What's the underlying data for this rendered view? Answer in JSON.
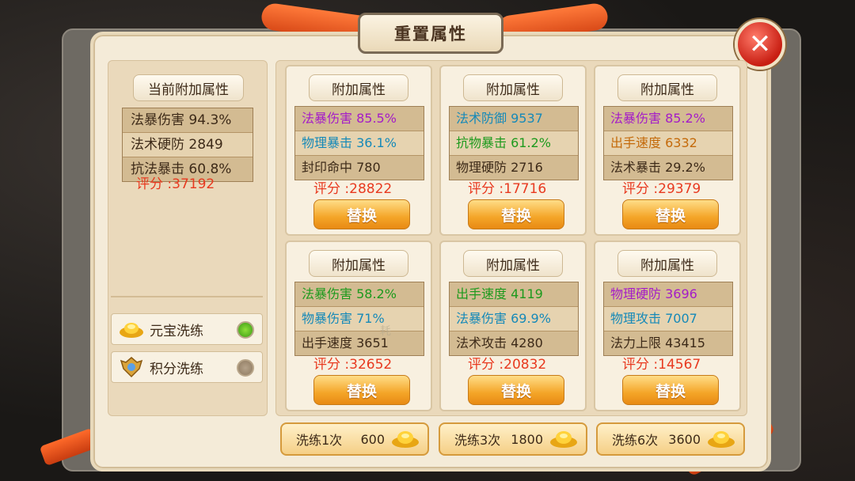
{
  "title": "重置属性",
  "current": {
    "label": "当前附加属性",
    "stats": [
      {
        "text": "法暴伤害 94.3%"
      },
      {
        "text": "法术硬防 2849"
      },
      {
        "text": "抗法暴击 60.8%"
      }
    ],
    "score": "评分 :37192"
  },
  "modes": [
    {
      "label": "元宝洗练",
      "icon": "gold-ingot-icon",
      "selected": true
    },
    {
      "label": "积分洗练",
      "icon": "points-badge-icon",
      "selected": false
    }
  ],
  "card_label": "附加属性",
  "swap_label": "替换",
  "cards": [
    {
      "stats": [
        {
          "text": "法暴伤害 85.5%",
          "color": "#a41cc8"
        },
        {
          "text": "物理暴击 36.1%",
          "color": "#1589b8"
        },
        {
          "text": "封印命中 780",
          "color": "#3d2a18"
        }
      ],
      "score": "评分 :28822"
    },
    {
      "stats": [
        {
          "text": "法术防御 9537",
          "color": "#1589b8"
        },
        {
          "text": "抗物暴击 61.2%",
          "color": "#1d9a1d"
        },
        {
          "text": "物理硬防 2716",
          "color": "#3d2a18"
        }
      ],
      "score": "评分 :17716"
    },
    {
      "stats": [
        {
          "text": "法暴伤害 85.2%",
          "color": "#a41cc8"
        },
        {
          "text": "出手速度 6332",
          "color": "#c46a0a"
        },
        {
          "text": "法术暴击 29.2%",
          "color": "#3d2a18"
        }
      ],
      "score": "评分 :29379"
    },
    {
      "stats": [
        {
          "text": "法暴伤害 58.2%",
          "color": "#1d9a1d"
        },
        {
          "text": "物暴伤害 71%",
          "color": "#1589b8"
        },
        {
          "text": "出手速度 3651",
          "color": "#3d2a18"
        }
      ],
      "score": "评分 :32652"
    },
    {
      "stats": [
        {
          "text": "出手速度 4119",
          "color": "#1d9a1d"
        },
        {
          "text": "法暴伤害 69.9%",
          "color": "#1589b8"
        },
        {
          "text": "法术攻击 4280",
          "color": "#3d2a18"
        }
      ],
      "score": "评分 :20832"
    },
    {
      "stats": [
        {
          "text": "物理硬防 3696",
          "color": "#a41cc8"
        },
        {
          "text": "物理攻击 7007",
          "color": "#1589b8"
        },
        {
          "text": "法力上限 43415",
          "color": "#3d2a18"
        }
      ],
      "score": "评分 :14567"
    }
  ],
  "refine_buttons": [
    {
      "label": "洗练1次",
      "cost": "600"
    },
    {
      "label": "洗练3次",
      "cost": "1800"
    },
    {
      "label": "洗练6次",
      "cost": "3600"
    }
  ],
  "faint_text": "耗"
}
